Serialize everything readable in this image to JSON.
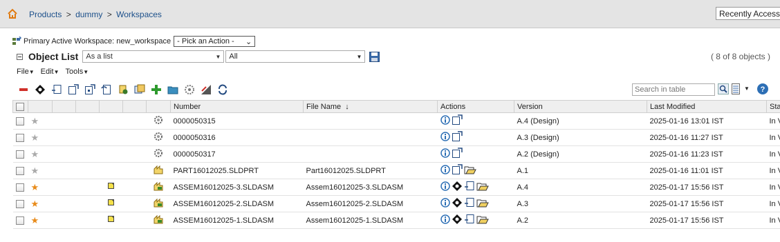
{
  "header": {
    "breadcrumb": [
      "Products",
      "dummy",
      "Workspaces"
    ],
    "separator": ">",
    "recently_accessed": "Recently Accessed"
  },
  "workspace": {
    "label": "Primary Active Workspace: new_workspace",
    "action_select": "- Pick an Action -"
  },
  "object_list": {
    "title": "Object List",
    "view": "As a list",
    "filter": "All",
    "count": "( 8 of 8 objects )"
  },
  "menus": [
    "File",
    "Edit",
    "Tools"
  ],
  "search": {
    "placeholder": "Search in table"
  },
  "colors": {
    "accent": "#1b4f8a",
    "star_on": "#e88b1a",
    "star_off": "#aaaaaa",
    "header_bg": "#efefef"
  },
  "table": {
    "columns": [
      "Number",
      "File Name",
      "Actions",
      "Version",
      "Last Modified",
      "Sta"
    ],
    "sort_indicator": "↓",
    "rows": [
      {
        "favorite": false,
        "status_flag": false,
        "type": "gear-icon",
        "number": "0000050315",
        "file_name": "",
        "actions": [
          "info-icon",
          "checkout-icon"
        ],
        "version": "A.4 (Design)",
        "modified": "2025-01-16 13:01 IST",
        "state": "In V"
      },
      {
        "favorite": false,
        "status_flag": false,
        "type": "gear-icon",
        "number": "0000050316",
        "file_name": "",
        "actions": [
          "info-icon",
          "checkout-icon"
        ],
        "version": "A.3 (Design)",
        "modified": "2025-01-16 11:27 IST",
        "state": "In V"
      },
      {
        "favorite": false,
        "status_flag": false,
        "type": "gear-icon",
        "number": "0000050317",
        "file_name": "",
        "actions": [
          "info-icon",
          "checkout-icon"
        ],
        "version": "A.2 (Design)",
        "modified": "2025-01-16 11:23 IST",
        "state": "In V"
      },
      {
        "favorite": false,
        "status_flag": false,
        "type": "part-icon",
        "number": "PART16012025.SLDPRT",
        "file_name": "Part16012025.SLDPRT",
        "actions": [
          "info-icon",
          "checkout-icon",
          "open-folder-icon"
        ],
        "version": "A.1",
        "modified": "2025-01-16 11:01 IST",
        "state": "In V"
      },
      {
        "favorite": true,
        "status_flag": true,
        "type": "assembly-icon",
        "number": "ASSEM16012025-3.SLDASM",
        "file_name": "Assem16012025-3.SLDASM",
        "actions": [
          "info-icon",
          "navigate-icon",
          "checkin-icon",
          "open-folder-icon"
        ],
        "version": "A.4",
        "modified": "2025-01-17 15:56 IST",
        "state": "In V"
      },
      {
        "favorite": true,
        "status_flag": true,
        "type": "assembly-icon",
        "number": "ASSEM16012025-2.SLDASM",
        "file_name": "Assem16012025-2.SLDASM",
        "actions": [
          "info-icon",
          "navigate-icon",
          "checkin-icon",
          "open-folder-icon"
        ],
        "version": "A.3",
        "modified": "2025-01-17 15:56 IST",
        "state": "In V"
      },
      {
        "favorite": true,
        "status_flag": true,
        "type": "assembly-icon",
        "number": "ASSEM16012025-1.SLDASM",
        "file_name": "Assem16012025-1.SLDASM",
        "actions": [
          "info-icon",
          "navigate-icon",
          "checkin-icon",
          "open-folder-icon"
        ],
        "version": "A.2",
        "modified": "2025-01-17 15:56 IST",
        "state": "In V"
      }
    ]
  }
}
